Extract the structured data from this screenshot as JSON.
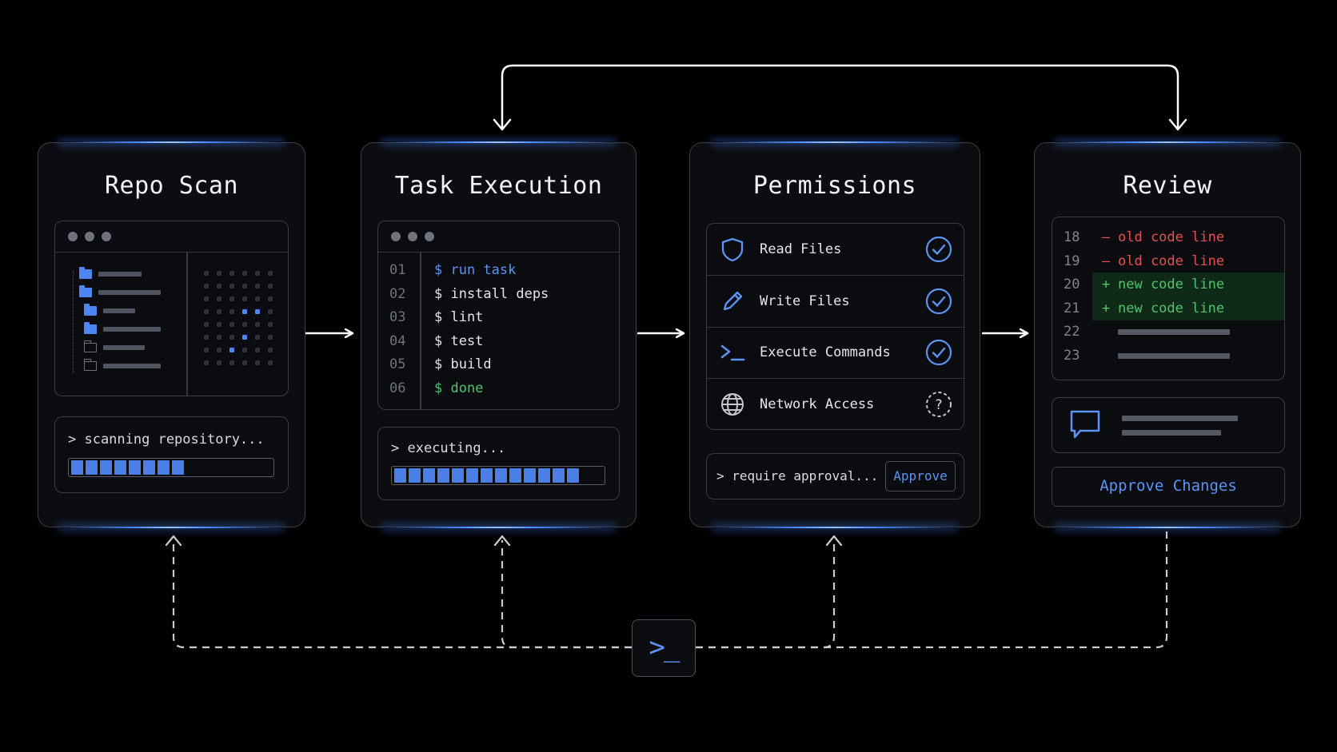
{
  "panels": {
    "repo_scan": {
      "title": "Repo Scan",
      "status": "> scanning repository...",
      "progress_segments": 8
    },
    "task_execution": {
      "title": "Task Execution",
      "lines": [
        {
          "num": "01",
          "text": "$ run task",
          "color": "#5b94f5"
        },
        {
          "num": "02",
          "text": "$ install deps",
          "color": "#e4e6ea"
        },
        {
          "num": "03",
          "text": "$ lint",
          "color": "#e4e6ea"
        },
        {
          "num": "04",
          "text": "$ test",
          "color": "#e4e6ea"
        },
        {
          "num": "05",
          "text": "$ build",
          "color": "#e4e6ea"
        },
        {
          "num": "06",
          "text": "$ done",
          "color": "#4fc46a"
        }
      ],
      "status": "> executing...",
      "progress_segments": 13
    },
    "permissions": {
      "title": "Permissions",
      "items": [
        {
          "label": "Read Files",
          "icon": "shield-icon",
          "status": "check"
        },
        {
          "label": "Write Files",
          "icon": "pencil-icon",
          "status": "check"
        },
        {
          "label": "Execute Commands",
          "icon": "terminal-icon",
          "status": "check"
        },
        {
          "label": "Network Access",
          "icon": "globe-icon",
          "status": "question"
        }
      ],
      "status": "> require approval...",
      "approve_label": "Approve"
    },
    "review": {
      "title": "Review",
      "diff": [
        {
          "num": "18",
          "marker": "–",
          "text": "old code line",
          "kind": "removed"
        },
        {
          "num": "19",
          "marker": "–",
          "text": "old code line",
          "kind": "removed"
        },
        {
          "num": "20",
          "marker": "+",
          "text": "new code line",
          "kind": "added"
        },
        {
          "num": "21",
          "marker": "+",
          "text": "new code line",
          "kind": "added"
        },
        {
          "num": "22",
          "marker": "",
          "text": "",
          "kind": "placeholder"
        },
        {
          "num": "23",
          "marker": "",
          "text": "",
          "kind": "placeholder"
        }
      ],
      "approve_changes_label": "Approve Changes"
    }
  },
  "hub": {
    "glyph": ">_",
    "icon": "terminal-icon"
  },
  "colors": {
    "accent": "#5b94f5",
    "progress": "#4c7fe6",
    "removed": "#e5504f",
    "added": "#4fc46a",
    "added_bg": "#0f2a18",
    "panel_glow": "#4a8dff"
  }
}
